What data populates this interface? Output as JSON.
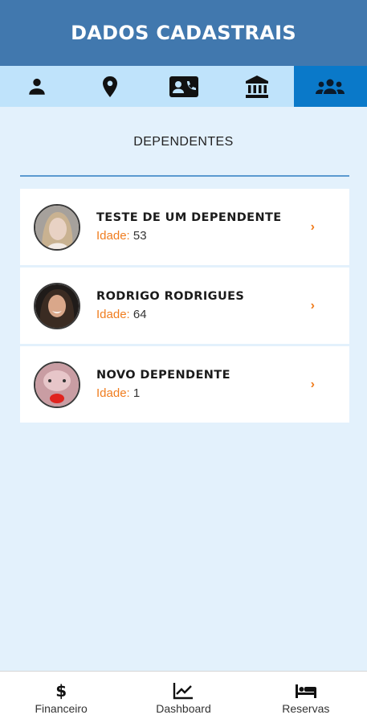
{
  "header": {
    "title": "DADOS CADASTRAIS"
  },
  "tabs": [
    {
      "icon": "person-icon",
      "active": false
    },
    {
      "icon": "location-pin-icon",
      "active": false
    },
    {
      "icon": "contact-card-icon",
      "active": false
    },
    {
      "icon": "bank-icon",
      "active": false
    },
    {
      "icon": "group-icon",
      "active": true
    }
  ],
  "section": {
    "title": "DEPENDENTES"
  },
  "dependents": [
    {
      "name": "TESTE DE UM DEPENDENTE",
      "age_label": "Idade:",
      "age": "53",
      "chevron": "›"
    },
    {
      "name": "RODRIGO RODRIGUES",
      "age_label": "Idade:",
      "age": "64",
      "chevron": "›"
    },
    {
      "name": "NOVO DEPENDENTE",
      "age_label": "Idade:",
      "age": "1",
      "chevron": "›"
    }
  ],
  "bottom_nav": {
    "financeiro": {
      "label": "Financeiro",
      "icon": "dollar-icon",
      "glyph": "$"
    },
    "dashboard": {
      "label": "Dashboard",
      "icon": "chart-line-icon"
    },
    "reservas": {
      "label": "Reservas",
      "icon": "bed-icon"
    }
  },
  "colors": {
    "header": "#4178ae",
    "tabbar": "#bfe3fb",
    "tab_active": "#0a79c9",
    "background": "#e3f1fc",
    "accent": "#f07d1f"
  }
}
